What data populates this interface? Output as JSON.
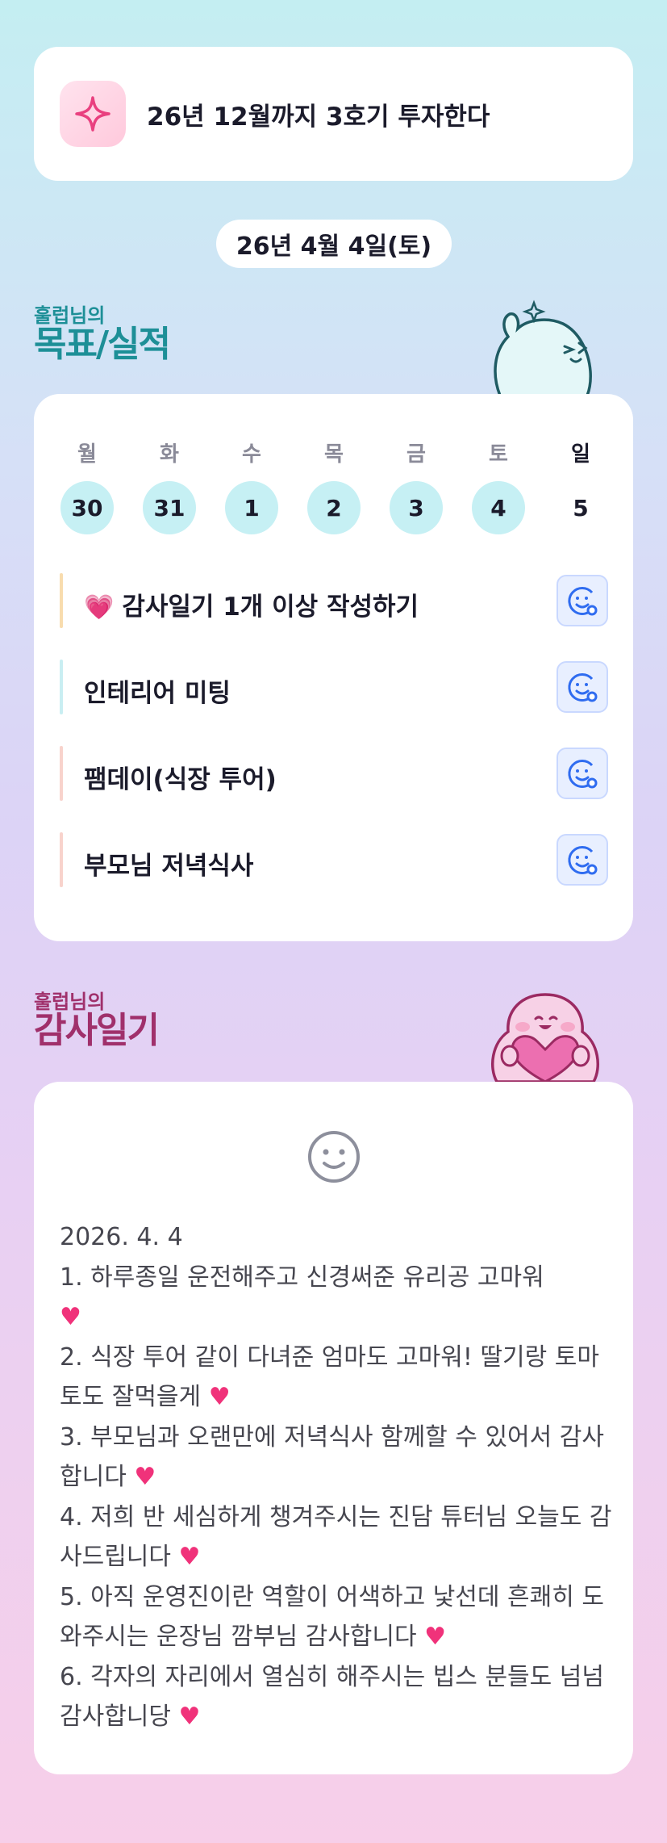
{
  "goal": {
    "text": "26년 12월까지 3호기 투자한다",
    "icon": "sparkle-icon"
  },
  "date": "26년 4월 4일(토)",
  "goals_section": {
    "owner": "훌럽님의",
    "title": "목표/실적"
  },
  "week": {
    "days": [
      {
        "label": "월",
        "num": "30"
      },
      {
        "label": "화",
        "num": "31"
      },
      {
        "label": "수",
        "num": "1"
      },
      {
        "label": "목",
        "num": "2"
      },
      {
        "label": "금",
        "num": "3"
      },
      {
        "label": "토",
        "num": "4"
      },
      {
        "label": "일",
        "num": "5"
      }
    ]
  },
  "tasks": [
    {
      "label": "감사일기 1개 이상 작성하기",
      "bar_color": "#f8dcae",
      "icon": "heart-icon"
    },
    {
      "label": "인테리어 미팅",
      "bar_color": "#c9eef2"
    },
    {
      "label": "팸데이(식장 투어)",
      "bar_color": "#f8d3cc"
    },
    {
      "label": "부모님 저녁식사",
      "bar_color": "#f8d3cc"
    }
  ],
  "diary_section": {
    "owner": "훌럽님의",
    "title": "감사일기"
  },
  "diary": {
    "date": "2026. 4. 4",
    "lines": [
      "1. 하루종일 운전해주고 신경써준 유리공 고마워",
      "2. 식장 투어 같이 다녀준 엄마도 고마워! 딸기랑 토마토도 잘먹을게",
      "3. 부모님과 오랜만에 저녁식사 함께할 수 있어서 감사합니다",
      "4. 저희 반 세심하게 챙겨주시는 진담 튜터님 오늘도 감사드립니다",
      "5. 아직 운영진이란 역할이 어색하고 낯선데 흔쾌히 도와주시는 운장님 깜부님 감사합니다",
      "6. 각자의 자리에서 열심히 해주시는 빕스 분들도 넘넘 감사합니당"
    ],
    "heart": "♥"
  },
  "colors": {
    "accent_teal": "#1d8f97",
    "accent_magenta": "#a0306b",
    "day_circle": "#c6f0f4",
    "heart": "#f0327a"
  }
}
